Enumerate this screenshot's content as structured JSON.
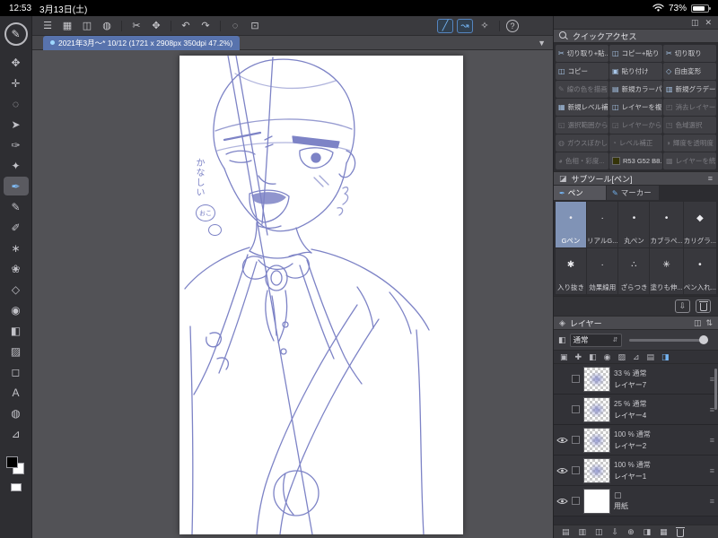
{
  "colors": {
    "accent_blue": "#74b4f2",
    "tab_blue": "#5873ad",
    "sketch_stroke": "#7d83c6",
    "quick_access_swatch_rgb": "#353408"
  },
  "status_bar": {
    "time": "12:53",
    "date": "3月13日(土)",
    "battery_percent": "73%"
  },
  "toolbar": {
    "icons": [
      {
        "name": "menu",
        "glyph": "☰"
      },
      {
        "name": "workspace",
        "glyph": "▦"
      },
      {
        "name": "import",
        "glyph": "◫"
      },
      {
        "name": "palette",
        "glyph": "◍"
      },
      {
        "name": "cut",
        "glyph": "✂"
      },
      {
        "name": "transform",
        "glyph": "✥"
      },
      {
        "name": "undo",
        "glyph": "↶"
      },
      {
        "name": "redo",
        "glyph": "↷"
      },
      {
        "name": "deselect",
        "glyph": "◌"
      },
      {
        "name": "crop",
        "glyph": "⊡"
      },
      {
        "name": "snap-line",
        "glyph": "╱"
      },
      {
        "name": "snap-curve",
        "glyph": "↝"
      },
      {
        "name": "snap-special",
        "glyph": "✧"
      },
      {
        "name": "help",
        "glyph": "?"
      }
    ]
  },
  "tab_bar": {
    "document_tab": "2021年3月〜* 10/12 (1721 x 2908px 350dpi 47.2%)"
  },
  "left_toolbar": {
    "tools": [
      {
        "name": "pan",
        "glyph": "✥"
      },
      {
        "name": "move",
        "glyph": "✛"
      },
      {
        "name": "lasso",
        "glyph": "◌"
      },
      {
        "name": "operation",
        "glyph": "➤"
      },
      {
        "name": "eyedropper",
        "glyph": "✑"
      },
      {
        "name": "auto-select",
        "glyph": "✦"
      },
      {
        "name": "pen",
        "glyph": "✒"
      },
      {
        "name": "pencil",
        "glyph": "✎"
      },
      {
        "name": "brush",
        "glyph": "✐"
      },
      {
        "name": "airbrush",
        "glyph": "∗"
      },
      {
        "name": "decoration",
        "glyph": "❀"
      },
      {
        "name": "eraser",
        "glyph": "◇"
      },
      {
        "name": "blend",
        "glyph": "◉"
      },
      {
        "name": "fill",
        "glyph": "◧"
      },
      {
        "name": "gradient",
        "glyph": "▨"
      },
      {
        "name": "figure",
        "glyph": "◻"
      },
      {
        "name": "text",
        "glyph": "A"
      },
      {
        "name": "balloon",
        "glyph": "◍"
      },
      {
        "name": "ruler",
        "glyph": "⊿"
      }
    ],
    "current_tool_glyph": "✎"
  },
  "canvas": {
    "note_text": "かなしい",
    "note_circled": "おこ"
  },
  "quick_access": {
    "title": "クイックアクセス",
    "items": [
      {
        "label": "切り取り+貼...",
        "glyph": "✂"
      },
      {
        "label": "コピー+貼り",
        "glyph": "◫"
      },
      {
        "label": "切り取り",
        "glyph": "✂"
      },
      {
        "label": "コピー",
        "glyph": "◫"
      },
      {
        "label": "貼り付け",
        "glyph": "▣"
      },
      {
        "label": "自由変形",
        "glyph": "◇"
      },
      {
        "label": "線の色を描画",
        "glyph": "✎"
      },
      {
        "label": "新規カラーパ",
        "glyph": "▤"
      },
      {
        "label": "新規グラデー",
        "glyph": "▥"
      },
      {
        "label": "新規レベル補",
        "glyph": "▦"
      },
      {
        "label": "レイヤーを複",
        "glyph": "◫"
      },
      {
        "label": "消去レイヤー",
        "glyph": "◰"
      },
      {
        "label": "選択範囲から",
        "glyph": "◱"
      },
      {
        "label": "レイヤーから",
        "glyph": "◲"
      },
      {
        "label": "色域選択",
        "glyph": "◳"
      },
      {
        "label": "ガウスぼかし",
        "glyph": "◍"
      },
      {
        "label": "レベル補正",
        "glyph": "◔"
      },
      {
        "label": "輝度を透明度",
        "glyph": "◑"
      },
      {
        "label": "色相・彩度...",
        "glyph": "◕"
      },
      {
        "label": "R53 G52 B8...",
        "glyph": ""
      },
      {
        "label": "レイヤーを統",
        "glyph": "▩"
      }
    ]
  },
  "subtool": {
    "title": "サブツール[ペン]",
    "tabs": [
      {
        "label": "ペン"
      },
      {
        "label": "マーカー"
      }
    ],
    "brushes": [
      {
        "label": "Gペン",
        "glyph": "•"
      },
      {
        "label": "リアルG...",
        "glyph": "·"
      },
      {
        "label": "丸ペン",
        "glyph": "•"
      },
      {
        "label": "カブラペ...",
        "glyph": "•"
      },
      {
        "label": "カリグラ...",
        "glyph": "◆"
      },
      {
        "label": "入り抜き",
        "glyph": "✱"
      },
      {
        "label": "効果線用",
        "glyph": "·"
      },
      {
        "label": "ざらつき",
        "glyph": "∴"
      },
      {
        "label": "塗りも伸...",
        "glyph": "✳"
      },
      {
        "label": "ペン入れ...",
        "glyph": "•"
      }
    ]
  },
  "layers_panel": {
    "title": "レイヤー",
    "blend_mode": "通常",
    "layers": [
      {
        "name": "レイヤー7",
        "opacity_mode": "33 % 通常"
      },
      {
        "name": "レイヤー4",
        "opacity_mode": "25 % 通常"
      },
      {
        "name": "レイヤー2",
        "opacity_mode": "100 % 通常"
      },
      {
        "name": "レイヤー1",
        "opacity_mode": "100 % 通常"
      },
      {
        "name": "用紙",
        "opacity_mode": ""
      }
    ]
  }
}
